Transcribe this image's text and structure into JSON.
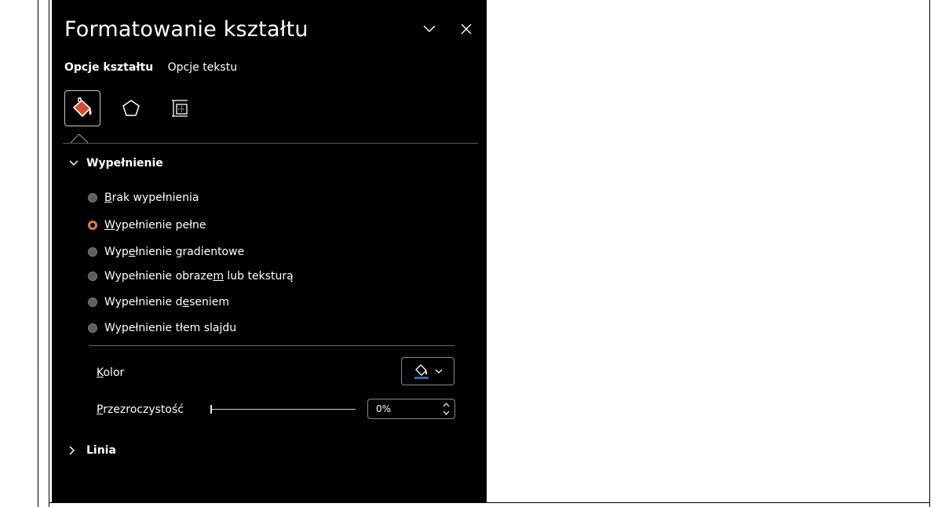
{
  "pane": {
    "title": "Formatowanie kształtu",
    "tabs": [
      "Opcje kształtu",
      "Opcje tekstu"
    ],
    "icon_tabs": [
      "fill-line-icon",
      "effects-pentagon-icon",
      "size-properties-icon"
    ]
  },
  "fill": {
    "header": "Wypełnienie",
    "options": [
      {
        "pre": "",
        "u": "B",
        "post": "rak wypełnienia",
        "checked": false
      },
      {
        "pre": "",
        "u": "W",
        "post": "ypełnienie pełne",
        "checked": true
      },
      {
        "pre": "Wyp",
        "u": "e",
        "post": "łnienie gradientowe",
        "checked": false
      },
      {
        "pre": "Wypełnienie obraze",
        "u": "m",
        "post": " lub teksturą",
        "checked": false
      },
      {
        "pre": "Wypełnienie d",
        "u": "e",
        "post": "seniem",
        "checked": false
      },
      {
        "pre": "Wypełnienie tłem sla",
        "u": "j",
        "post": "du",
        "checked": false
      }
    ],
    "color": {
      "pre": "",
      "u": "K",
      "post": "olor",
      "swatch": "#1f6fb2"
    },
    "transparency": {
      "pre": "",
      "u": "P",
      "post": "rzezroczystość",
      "value": "0%"
    }
  },
  "line": {
    "header": "Linia"
  },
  "colors": {
    "accent": "#e07a3a",
    "pane_bg": "#000000"
  }
}
